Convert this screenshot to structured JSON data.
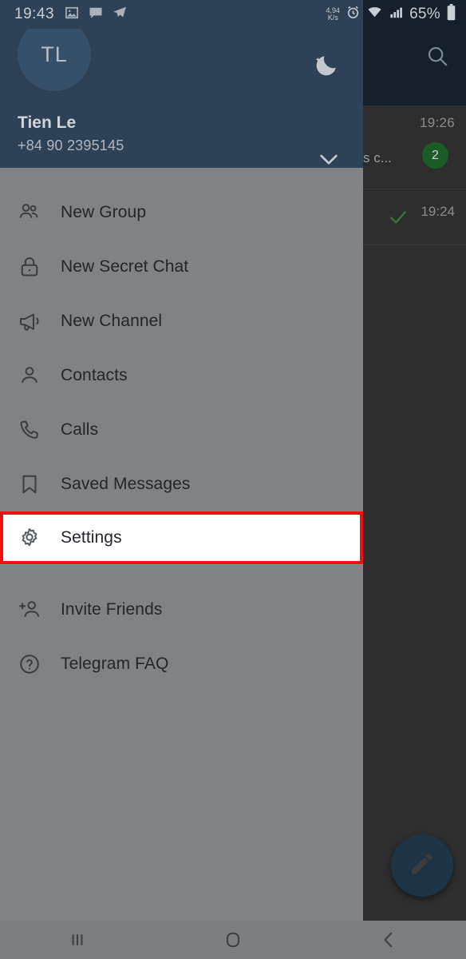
{
  "status_bar": {
    "time": "19:43",
    "icons_left": [
      "photo-icon",
      "chat-icon",
      "telegram-icon"
    ],
    "network_speed_value": "4,94",
    "network_speed_unit": "K/s",
    "icons_right": [
      "alarm-icon",
      "wifi-icon",
      "signal-icon"
    ],
    "battery": "65%",
    "battery_icon": "battery-icon"
  },
  "drawer": {
    "avatar_initials": "TL",
    "profile_name": "Tien Le",
    "profile_phone": "+84 90 2395145",
    "night_mode_icon": "moon-icon",
    "expand_icon": "chevron-down-icon",
    "menu": [
      {
        "label": "New Group",
        "icon": "group-icon",
        "highlighted": false
      },
      {
        "label": "New Secret Chat",
        "icon": "lock-icon",
        "highlighted": false
      },
      {
        "label": "New Channel",
        "icon": "megaphone-icon",
        "highlighted": false
      },
      {
        "label": "Contacts",
        "icon": "person-icon",
        "highlighted": false
      },
      {
        "label": "Calls",
        "icon": "phone-icon",
        "highlighted": false
      },
      {
        "label": "Saved Messages",
        "icon": "bookmark-icon",
        "highlighted": false
      },
      {
        "label": "Settings",
        "icon": "gear-icon",
        "highlighted": true
      },
      {
        "label": "Invite Friends",
        "icon": "person-add-icon",
        "highlighted": false
      },
      {
        "label": "Telegram FAQ",
        "icon": "question-circle-icon",
        "highlighted": false
      }
    ]
  },
  "background_app": {
    "search_icon": "search-icon",
    "chats": [
      {
        "time": "19:26",
        "snippet": "s c...",
        "unread": "2"
      },
      {
        "time": "19:24",
        "read_status_icon": "check-icon"
      }
    ],
    "compose_fab_icon": "pencil-icon"
  },
  "nav_bar": {
    "recents_label": "recents-button",
    "home_label": "home-button",
    "back_label": "back-button"
  },
  "colors": {
    "header_blue": "#2e4257",
    "drawer_gray": "#808285",
    "highlight_red": "#ee1111",
    "badge_green": "#1c5c29",
    "dark_navy": "#15202b"
  }
}
